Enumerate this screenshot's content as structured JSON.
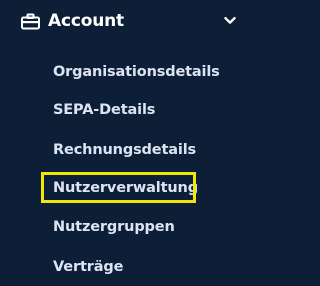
{
  "menu": {
    "title": "Account",
    "icon": "briefcase-icon",
    "chevron_icon": "chevron-down-icon",
    "items": [
      {
        "label": "Organisationsdetails"
      },
      {
        "label": "SEPA-Details"
      },
      {
        "label": "Rechnungsdetails"
      },
      {
        "label": "Nutzerverwaltung",
        "highlighted": true
      },
      {
        "label": "Nutzergruppen"
      },
      {
        "label": "Verträge"
      }
    ]
  },
  "colors": {
    "background": "#0d1f37",
    "text": "#dbe4f2",
    "title": "#ffffff",
    "highlight": "#f1e50a"
  }
}
